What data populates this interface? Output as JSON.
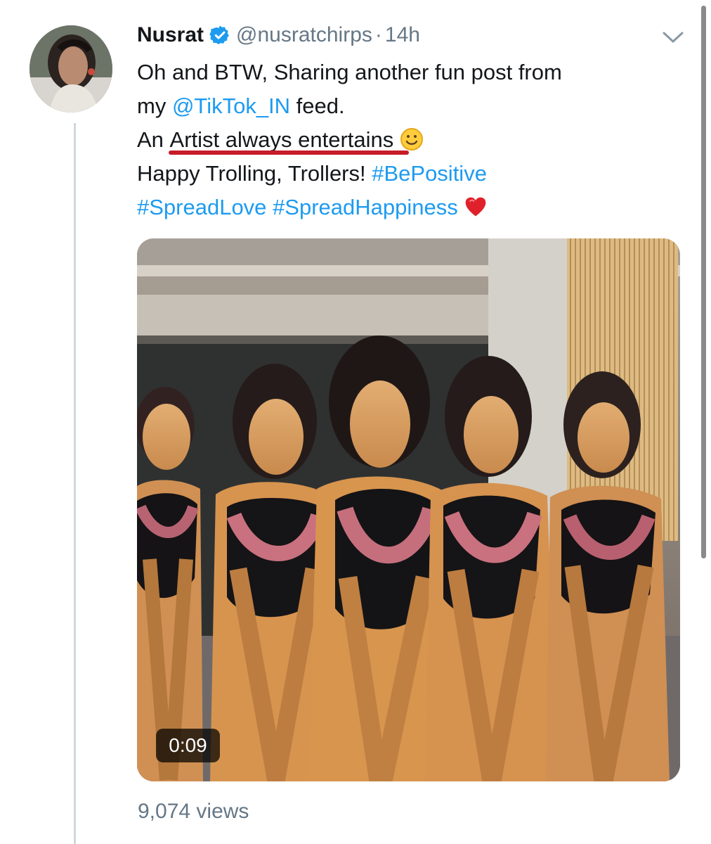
{
  "tweet": {
    "author": {
      "display_name": "Nusrat",
      "handle": "@nusratchirps",
      "verified_icon": "verified-badge-icon"
    },
    "separator": "·",
    "timestamp": "14h",
    "menu_icon": "chevron-down-icon",
    "text": {
      "line1": "Oh and BTW, Sharing another fun post from",
      "line2_prefix": "my ",
      "mention": "@TikTok_IN",
      "line2_suffix": " feed.",
      "line3_prefix": "An ",
      "line3_underlined": "Artist always entertains",
      "line3_emoji": "smile-emoji",
      "line4_prefix": "Happy Trolling, Trollers! ",
      "hashtag_1": "#BePositive",
      "hashtag_2": "#SpreadLove",
      "hashtag_3": "#SpreadHappiness",
      "heart_emoji": "heart-emoji"
    },
    "colors": {
      "link": "#1d9bf0",
      "text": "#14171a",
      "muted": "#657786",
      "underline_mark": "#c71b28",
      "verified": "#1d9bf0"
    },
    "video": {
      "duration": "0:09"
    },
    "views": "9,074 views"
  }
}
